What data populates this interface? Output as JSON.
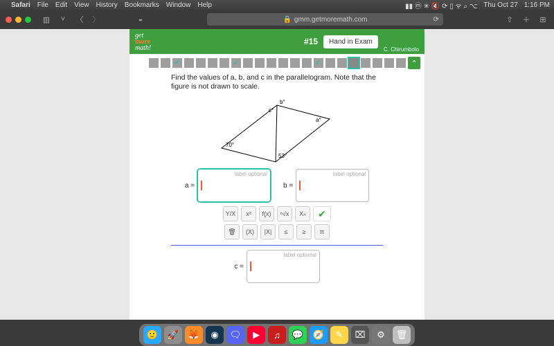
{
  "menubar": {
    "apple": "",
    "app": "Safari",
    "items": [
      "File",
      "Edit",
      "View",
      "History",
      "Bookmarks",
      "Window",
      "Help"
    ],
    "right": {
      "date": "Thu Oct 27",
      "time": "1:16 PM"
    }
  },
  "browser": {
    "url": "gmm.getmoremath.com",
    "lock": "🔒"
  },
  "header": {
    "logo_line1": "get",
    "logo_line2": "more",
    "logo_line3": "math!",
    "qnum": "#15",
    "hand": "Hand in Exam",
    "user": "C. Chirumbolo"
  },
  "progress": {
    "total": 22,
    "done": [
      3,
      8,
      15
    ],
    "current": 18
  },
  "question": {
    "text": "Find the values of a, b, and c in the parallelogram. Note that the figure is not drawn to scale."
  },
  "figure": {
    "angle_left": "70°",
    "angle_bottom": "53°",
    "lbl_a": "a°",
    "lbl_b": "b°",
    "lbl_c": "c°"
  },
  "answers": {
    "a_label": "a =",
    "b_label": "b =",
    "c_label": "c =",
    "placeholder": "label optional"
  },
  "tools": {
    "row1": [
      "Y/X",
      "x²",
      "f(x)",
      "ⁿ√x",
      "Xₙ"
    ],
    "row2": [
      "🗑",
      "(X)",
      "|X|",
      "≤",
      "≥",
      "π"
    ]
  },
  "dock": {
    "items": [
      {
        "name": "finder",
        "bg": "#2aa7ff",
        "glyph": "🙂"
      },
      {
        "name": "launchpad",
        "bg": "#8e8e8e",
        "glyph": "🚀"
      },
      {
        "name": "firefox",
        "bg": "#ff8a2a",
        "glyph": "🦊"
      },
      {
        "name": "steam",
        "bg": "#14344f",
        "glyph": "◉"
      },
      {
        "name": "discord",
        "bg": "#5865f2",
        "glyph": "🗨"
      },
      {
        "name": "youtube",
        "bg": "#ff0033",
        "glyph": "▶"
      },
      {
        "name": "youtube-music",
        "bg": "#c61d1d",
        "glyph": "♫"
      },
      {
        "name": "messages",
        "bg": "#30d158",
        "glyph": "💬"
      },
      {
        "name": "safari",
        "bg": "#1e9bff",
        "glyph": "🧭"
      },
      {
        "name": "notes",
        "bg": "#ffd54a",
        "glyph": "✎"
      },
      {
        "name": "screenshot",
        "bg": "#555",
        "glyph": "⌧"
      },
      {
        "name": "settings",
        "bg": "#777",
        "glyph": "⚙"
      },
      {
        "name": "trash",
        "bg": "#bfbfbf",
        "glyph": "🗑"
      }
    ]
  }
}
